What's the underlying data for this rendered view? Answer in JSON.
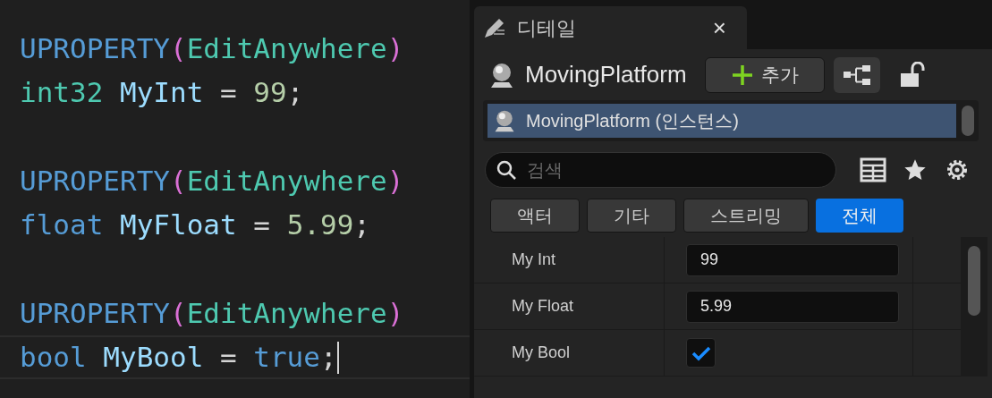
{
  "code": {
    "blocks": [
      {
        "lines": [
          {
            "current": false,
            "tokens": [
              {
                "text": "UPROPERTY",
                "kind": "macro"
              },
              {
                "text": "(",
                "kind": "paren"
              },
              {
                "text": "EditAnywhere",
                "kind": "type"
              },
              {
                "text": ")",
                "kind": "paren"
              }
            ]
          },
          {
            "current": false,
            "tokens": [
              {
                "text": "int32",
                "kind": "type"
              },
              {
                "text": "MyInt",
                "kind": "variable"
              },
              {
                "text": " = ",
                "kind": "punct"
              },
              {
                "text": "99",
                "kind": "number"
              },
              {
                "text": ";",
                "kind": "punct"
              }
            ]
          }
        ]
      },
      {
        "lines": [
          {
            "current": false,
            "tokens": [
              {
                "text": "UPROPERTY",
                "kind": "macro"
              },
              {
                "text": "(",
                "kind": "paren"
              },
              {
                "text": "EditAnywhere",
                "kind": "type"
              },
              {
                "text": ")",
                "kind": "paren"
              }
            ]
          },
          {
            "current": false,
            "tokens": [
              {
                "text": "float",
                "kind": "keyword"
              },
              {
                "text": "MyFloat",
                "kind": "variable"
              },
              {
                "text": " = ",
                "kind": "punct"
              },
              {
                "text": "5.99",
                "kind": "number"
              },
              {
                "text": ";",
                "kind": "punct"
              }
            ]
          }
        ]
      },
      {
        "lines": [
          {
            "current": false,
            "tokens": [
              {
                "text": "UPROPERTY",
                "kind": "macro"
              },
              {
                "text": "(",
                "kind": "paren"
              },
              {
                "text": "EditAnywhere",
                "kind": "type"
              },
              {
                "text": ")",
                "kind": "paren"
              }
            ]
          },
          {
            "current": true,
            "tokens": [
              {
                "text": "bool",
                "kind": "keyword"
              },
              {
                "text": "MyBool",
                "kind": "variable"
              },
              {
                "text": " = ",
                "kind": "punct"
              },
              {
                "text": "true",
                "kind": "keyword"
              },
              {
                "text": ";",
                "kind": "punct"
              }
            ]
          }
        ]
      }
    ]
  },
  "details": {
    "tab": {
      "title": "디테일",
      "close": "×"
    },
    "actor": {
      "name": "MovingPlatform",
      "add_button": "추가"
    },
    "components": [
      {
        "label": "MovingPlatform (인스턴스)",
        "selected": true
      }
    ],
    "search": {
      "placeholder": "검색"
    },
    "filters": [
      {
        "label": "액터",
        "selected": false
      },
      {
        "label": "기타",
        "selected": false
      },
      {
        "label": "스트리밍",
        "selected": false
      },
      {
        "label": "전체",
        "selected": true
      }
    ],
    "properties": [
      {
        "kind": "text",
        "name": "My Int",
        "value": "99"
      },
      {
        "kind": "text",
        "name": "My Float",
        "value": "5.99"
      },
      {
        "kind": "checkbox",
        "name": "My Bool",
        "checked": true
      }
    ]
  }
}
